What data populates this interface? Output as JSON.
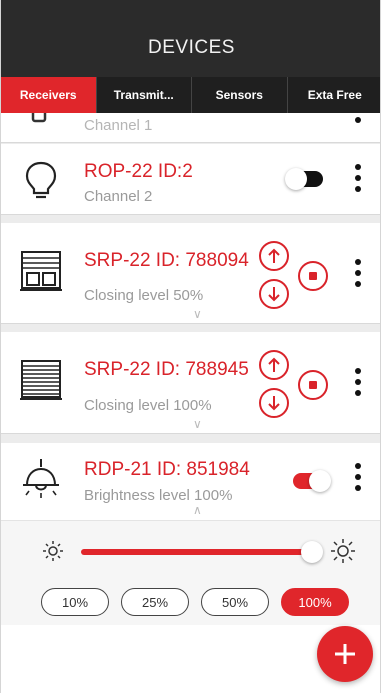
{
  "header": {
    "title": "DEVICES"
  },
  "tabs": [
    {
      "label": "Receivers",
      "active": true
    },
    {
      "label": "Transmit...",
      "active": false
    },
    {
      "label": "Sensors",
      "active": false
    },
    {
      "label": "Exta Free",
      "active": false
    }
  ],
  "devices": [
    {
      "name": "",
      "sub": "Channel 1",
      "icon": "plug-icon"
    },
    {
      "name": "ROP-22 ID:2",
      "sub": "Channel 2",
      "icon": "bulb-icon",
      "toggle_on": false
    },
    {
      "name": "SRP-22 ID: 788094",
      "sub": "Closing level 50%",
      "icon": "window-blind-icon"
    },
    {
      "name": "SRP-22 ID: 788945",
      "sub": "Closing level 100%",
      "icon": "roller-blind-icon"
    },
    {
      "name": "RDP-21 ID: 851984",
      "sub": "Brightness level 100%",
      "icon": "ceiling-lamp-icon",
      "toggle_on": true
    }
  ],
  "dimmer": {
    "level_percent": 100,
    "presets": [
      {
        "label": "10%",
        "active": false
      },
      {
        "label": "25%",
        "active": false
      },
      {
        "label": "50%",
        "active": false
      },
      {
        "label": "100%",
        "active": true
      }
    ]
  },
  "fab": {
    "icon": "plus-icon"
  },
  "colors": {
    "accent": "#e0262b",
    "header": "#2b2b2b",
    "tabbar": "#1f1f1f"
  }
}
